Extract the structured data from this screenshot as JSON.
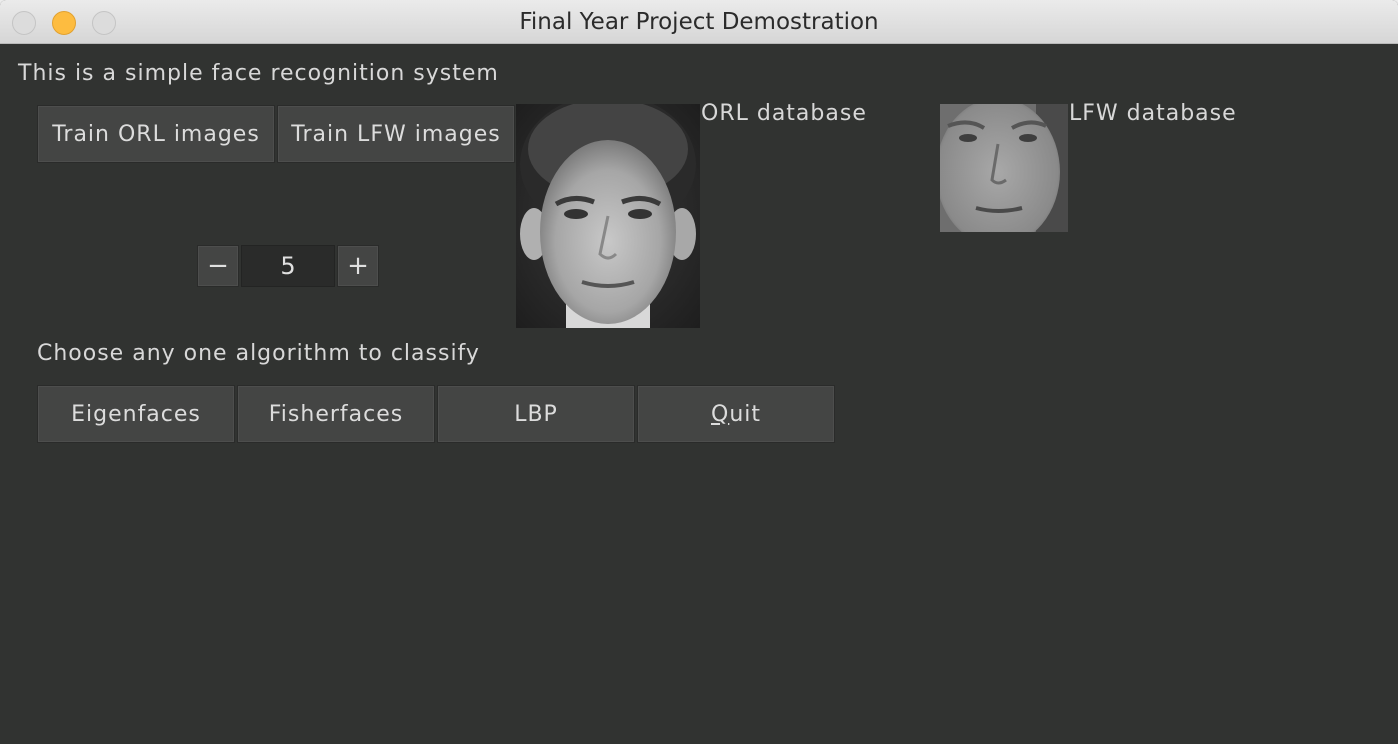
{
  "window": {
    "title": "Final Year Project Demostration"
  },
  "intro_text": "This is a simple face recognition system",
  "train_buttons": {
    "orl": "Train ORL images",
    "lfw": "Train LFW images"
  },
  "stepper": {
    "value": "5",
    "minus_label": "−",
    "plus_label": "+"
  },
  "databases": {
    "orl_label": "ORL database",
    "lfw_label": "LFW database"
  },
  "classify_text": "Choose any one algorithm to classify",
  "algorithm_buttons": {
    "eigenfaces": "Eigenfaces",
    "fisherfaces": "Fisherfaces",
    "lbp": "LBP",
    "quit": "Quit"
  },
  "colors": {
    "background": "#313331",
    "button": "#444544",
    "text": "#d8d8d8",
    "minimize_button": "#fdbc40"
  }
}
